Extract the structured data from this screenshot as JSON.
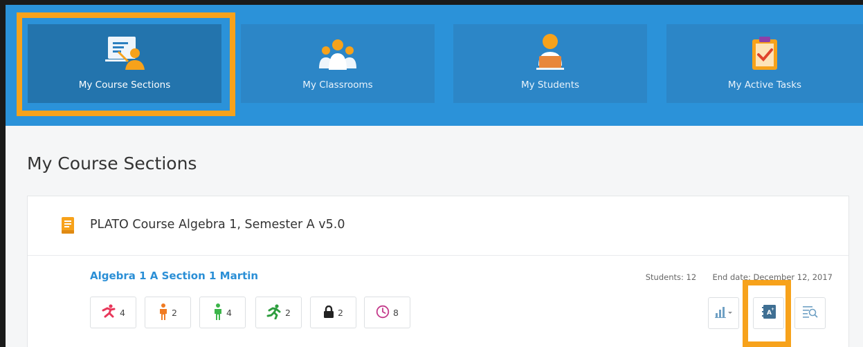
{
  "colors": {
    "topbar": "#2b92d9",
    "tile": "#2c86c7",
    "tile_active": "#2374ad",
    "highlight": "#f7a21b",
    "link": "#2b8fd6"
  },
  "nav": {
    "items": [
      {
        "label": "My Course Sections",
        "icon": "teacher-board-icon",
        "active": true
      },
      {
        "label": "My Classrooms",
        "icon": "classroom-group-icon",
        "active": false
      },
      {
        "label": "My Students",
        "icon": "student-laptop-icon",
        "active": false
      },
      {
        "label": "My Active Tasks",
        "icon": "clipboard-check-icon",
        "active": false
      }
    ]
  },
  "page": {
    "title": "My Course Sections"
  },
  "course": {
    "icon": "book-icon",
    "title": "PLATO Course Algebra 1, Semester A v5.0",
    "section": {
      "name": "Algebra 1 A Section 1 Martin",
      "students_label": "Students:",
      "students_value": "12",
      "end_label": "End date:",
      "end_value": "December 12, 2017",
      "badges": [
        {
          "icon": "falling-runner-icon",
          "count": "4",
          "color": "#e8375a"
        },
        {
          "icon": "person-orange-icon",
          "count": "2",
          "color": "#f07b22"
        },
        {
          "icon": "person-green-icon",
          "count": "4",
          "color": "#3cb54a"
        },
        {
          "icon": "runner-green-icon",
          "count": "2",
          "color": "#2e9e3f"
        },
        {
          "icon": "lock-icon",
          "count": "2",
          "color": "#222222"
        },
        {
          "icon": "clock-icon",
          "count": "8",
          "color": "#c3398a"
        }
      ],
      "tools": [
        {
          "icon": "bar-chart-dropdown-icon"
        },
        {
          "icon": "gradebook-icon"
        },
        {
          "icon": "list-search-icon"
        }
      ]
    }
  }
}
